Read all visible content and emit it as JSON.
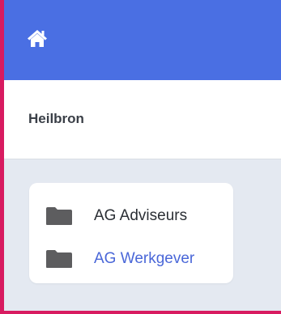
{
  "colors": {
    "topbar": "#4a6fe3",
    "accent": "#d81b60",
    "background": "#e4e9f1",
    "link": "#4a67d8",
    "folder_icon": "#5d5d5f"
  },
  "topbar": {
    "home_icon": "home-icon"
  },
  "breadcrumb": {
    "title": "Heilbron"
  },
  "folders": {
    "items": [
      {
        "label": "AG Adviseurs",
        "icon": "folder-icon"
      },
      {
        "label": "AG Werkgever",
        "icon": "folder-icon"
      }
    ]
  }
}
